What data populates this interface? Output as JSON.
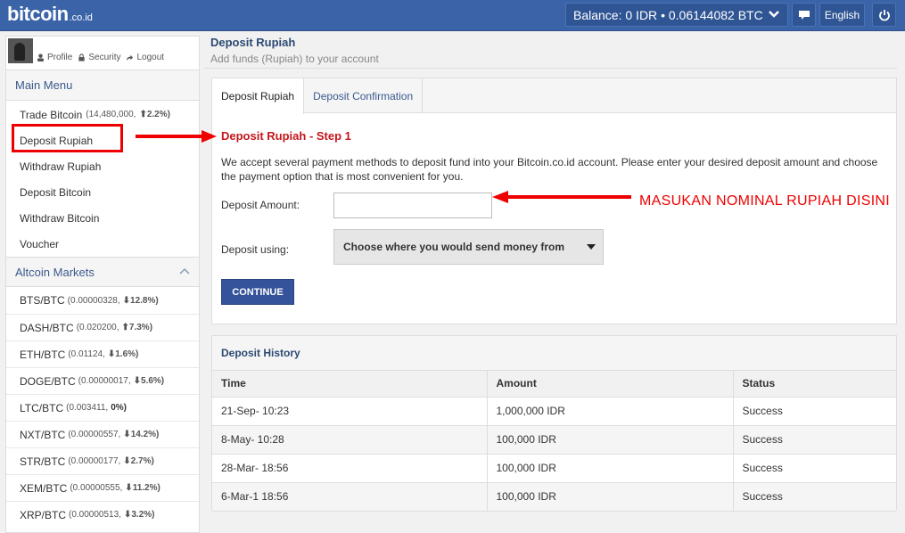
{
  "header": {
    "logo_main": "bitcoin",
    "logo_sub": ".co.id",
    "balance_label": "Balance:",
    "balance_idr": "0 IDR",
    "balance_sep": "•",
    "balance_btc": "0.06144082 BTC",
    "language": "English"
  },
  "profile": {
    "links": [
      "Profile",
      "Security",
      "Logout"
    ]
  },
  "sidebar": {
    "main_menu_title": "Main Menu",
    "items": [
      {
        "label": "Trade Bitcoin",
        "sub": "(14,480,000,",
        "change": "2.2%)",
        "dir": "up"
      },
      {
        "label": "Deposit Rupiah"
      },
      {
        "label": "Withdraw Rupiah"
      },
      {
        "label": "Deposit Bitcoin"
      },
      {
        "label": "Withdraw Bitcoin"
      },
      {
        "label": "Voucher"
      }
    ],
    "altcoin_title": "Altcoin Markets",
    "altcoins": [
      {
        "pair": "BTS/BTC",
        "price": "(0.00000328,",
        "change": "12.8%)",
        "dir": "down"
      },
      {
        "pair": "DASH/BTC",
        "price": "(0.020200,",
        "change": "7.3%)",
        "dir": "up"
      },
      {
        "pair": "ETH/BTC",
        "price": "(0.01124,",
        "change": "1.6%)",
        "dir": "down"
      },
      {
        "pair": "DOGE/BTC",
        "price": "(0.00000017,",
        "change": "5.6%)",
        "dir": "down"
      },
      {
        "pair": "LTC/BTC",
        "price": "(0.003411,",
        "change": "0%)",
        "dir": "flat"
      },
      {
        "pair": "NXT/BTC",
        "price": "(0.00000557,",
        "change": "14.2%)",
        "dir": "down"
      },
      {
        "pair": "STR/BTC",
        "price": "(0.00000177,",
        "change": "2.7%)",
        "dir": "down"
      },
      {
        "pair": "XEM/BTC",
        "price": "(0.00000555,",
        "change": "11.2%)",
        "dir": "down"
      },
      {
        "pair": "XRP/BTC",
        "price": "(0.00000513,",
        "change": "3.2%)",
        "dir": "down"
      }
    ]
  },
  "page": {
    "title": "Deposit Rupiah",
    "subtitle": "Add funds (Rupiah) to your account"
  },
  "tabs": [
    "Deposit Rupiah",
    "Deposit Confirmation"
  ],
  "form": {
    "step_title": "Deposit Rupiah - Step 1",
    "description": "We accept several payment methods to deposit fund into your Bitcoin.co.id account. Please enter your desired deposit amount and choose the payment option that is most convenient for you.",
    "amount_label": "Deposit Amount:",
    "amount_value": "",
    "using_label": "Deposit using:",
    "using_selected": "Choose where you would send money from",
    "continue_label": "CONTINUE"
  },
  "history": {
    "title": "Deposit History",
    "columns": [
      "Time",
      "Amount",
      "Status"
    ],
    "rows": [
      [
        "21-Sep-  10:23",
        "1,000,000 IDR",
        "Success"
      ],
      [
        "8-May-  10:28",
        "100,000 IDR",
        "Success"
      ],
      [
        "28-Mar-  18:56",
        "100,000 IDR",
        "Success"
      ],
      [
        "6-Mar-1  18:56",
        "100,000 IDR",
        "Success"
      ]
    ]
  },
  "annotation": {
    "text": "MASUKAN NOMINAL RUPIAH DISINI"
  },
  "colors": {
    "brand": "#3a63a8",
    "annotation": "#ee0000",
    "up": "#3a8a2e",
    "down": "#c0392b"
  }
}
